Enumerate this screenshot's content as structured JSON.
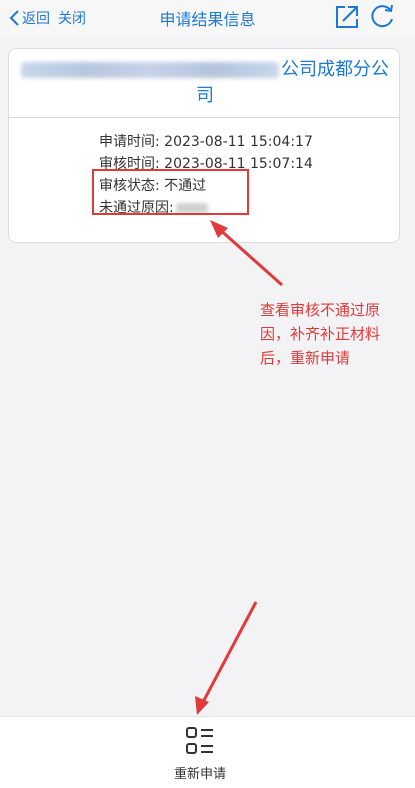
{
  "header": {
    "back_label": "返回",
    "close_label": "关闭",
    "title": "申请结果信息",
    "accent_color": "#1d78d6"
  },
  "card": {
    "title_suffix_line1": "公司成都分公",
    "title_suffix_line2": "司",
    "rows": [
      {
        "label": "申请时间:",
        "value": "2023-08-11 15:04:17"
      },
      {
        "label": "审核时间:",
        "value": "2023-08-11 15:07:14"
      },
      {
        "label": "审核状态:",
        "value": "不通过"
      },
      {
        "label": "未通过原因:",
        "value": ""
      }
    ]
  },
  "annotation": {
    "note": "查看审核不通过原因，补齐补正材料后，重新申请",
    "color": "#e23a3a"
  },
  "bottom": {
    "reapply_label": "重新申请",
    "reapply_icon": "list-icon"
  }
}
